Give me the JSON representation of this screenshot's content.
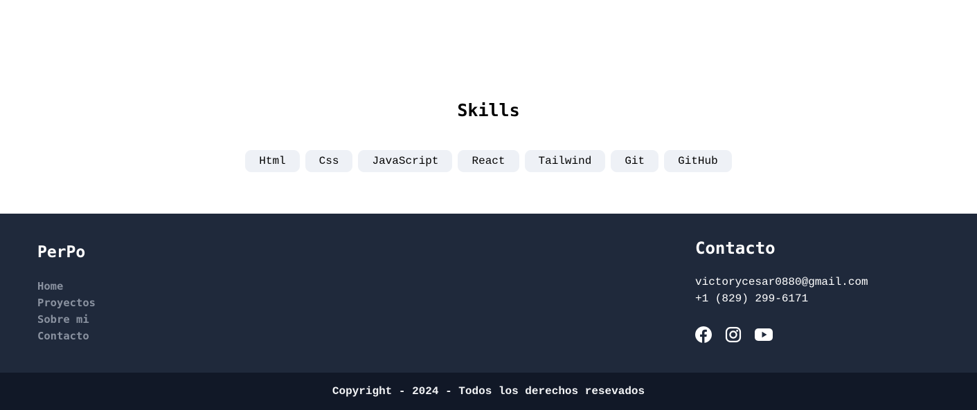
{
  "skills": {
    "title": "Skills",
    "items": [
      "Html",
      "Css",
      "JavaScript",
      "React",
      "Tailwind",
      "Git",
      "GitHub"
    ]
  },
  "footer": {
    "brand": "PerPo",
    "nav": [
      "Home",
      "Proyectos",
      "Sobre mi",
      "Contacto"
    ],
    "contact": {
      "title": "Contacto",
      "email": "victorycesar0880@gmail.com",
      "phone": "+1 (829) 299-6171",
      "socials": [
        "facebook-icon",
        "instagram-icon",
        "youtube-icon"
      ]
    },
    "copyright": "Copyright - 2024 - Todos los derechos resevados"
  },
  "colors": {
    "footer_bg": "#1f293b",
    "copyright_bg": "#111827",
    "skill_tag_bg": "#eef1f6",
    "nav_link": "#8a92a0"
  }
}
